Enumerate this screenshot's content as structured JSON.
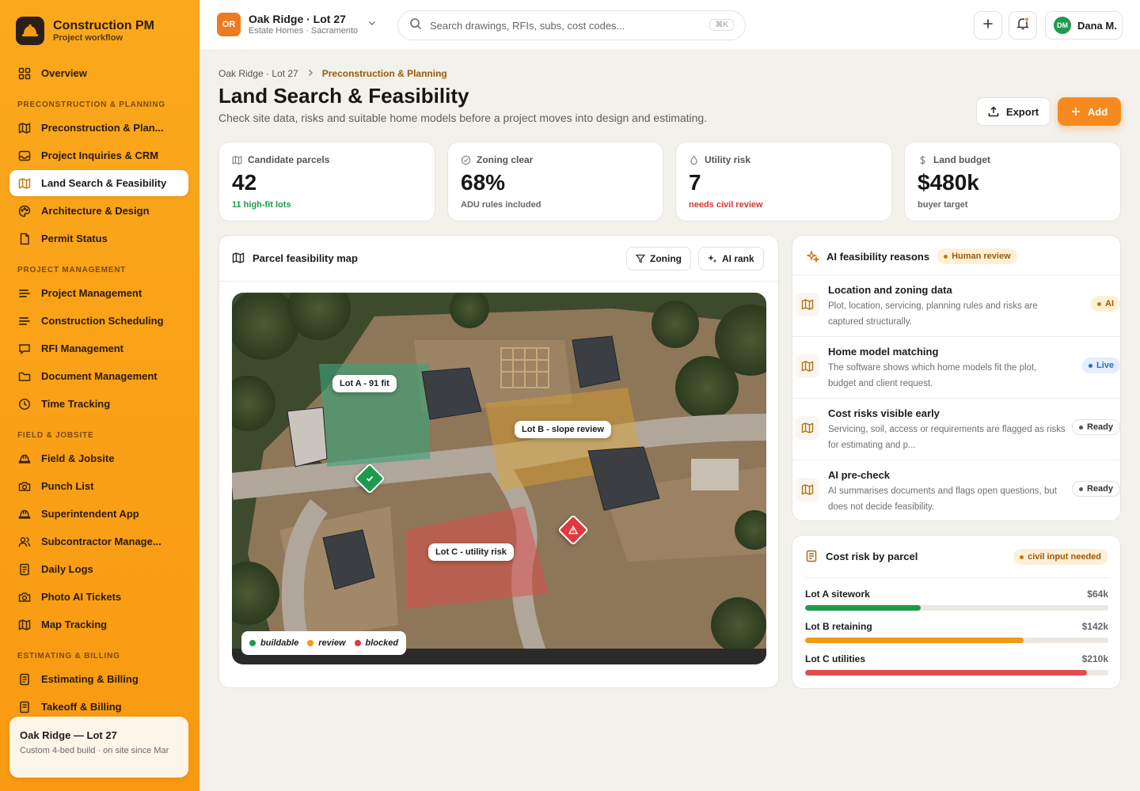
{
  "brand": {
    "title": "Construction PM",
    "subtitle": "Project workflow"
  },
  "sidebar": {
    "overview": "Overview",
    "sections": [
      {
        "title": "PRECONSTRUCTION & PLANNING",
        "items": [
          {
            "label": "Preconstruction & Plan...",
            "icon": "map-icon"
          },
          {
            "label": "Project Inquiries & CRM",
            "icon": "inbox-icon"
          },
          {
            "label": "Land Search & Feasibility",
            "icon": "map-icon",
            "active": true
          },
          {
            "label": "Architecture & Design",
            "icon": "palette-icon"
          },
          {
            "label": "Permit Status",
            "icon": "document-icon"
          }
        ]
      },
      {
        "title": "PROJECT MANAGEMENT",
        "items": [
          {
            "label": "Project Management",
            "icon": "list-icon"
          },
          {
            "label": "Construction Scheduling",
            "icon": "list-icon"
          },
          {
            "label": "RFI Management",
            "icon": "message-icon"
          },
          {
            "label": "Document Management",
            "icon": "folder-icon"
          },
          {
            "label": "Time Tracking",
            "icon": "clock-icon"
          }
        ]
      },
      {
        "title": "FIELD & JOBSITE",
        "items": [
          {
            "label": "Field & Jobsite",
            "icon": "hardhat-icon"
          },
          {
            "label": "Punch List",
            "icon": "camera-icon"
          },
          {
            "label": "Superintendent App",
            "icon": "hardhat-icon"
          },
          {
            "label": "Subcontractor Manage...",
            "icon": "users-icon"
          },
          {
            "label": "Daily Logs",
            "icon": "document-icon"
          },
          {
            "label": "Photo AI Tickets",
            "icon": "camera-icon"
          },
          {
            "label": "Map Tracking",
            "icon": "map-icon"
          }
        ]
      },
      {
        "title": "ESTIMATING & BILLING",
        "items": [
          {
            "label": "Estimating & Billing",
            "icon": "document-icon"
          },
          {
            "label": "Takeoff & Billing",
            "icon": "document-icon"
          }
        ]
      }
    ],
    "project_card": {
      "title": "Oak Ridge — Lot 27",
      "subtitle": "Custom 4-bed build · on site since Mar"
    }
  },
  "topbar": {
    "project_initials": "OR",
    "project_name": "Oak Ridge · Lot 27",
    "project_org": "Estate Homes · Sacramento",
    "search_placeholder": "Search drawings, RFIs, subs, cost codes...",
    "search_shortcut": "⌘K",
    "user_initials": "DM",
    "user_name": "Dana M."
  },
  "header": {
    "breadcrumb_root": "Oak Ridge · Lot 27",
    "breadcrumb_current": "Preconstruction & Planning",
    "title": "Land Search & Feasibility",
    "subtitle": "Check site data, risks and suitable home models before a project moves into design and estimating.",
    "export_label": "Export",
    "add_label": "Add"
  },
  "kpis": [
    {
      "label": "Candidate parcels",
      "value": "42",
      "note": "11 high-fit lots",
      "note_color": "#1e9a4c",
      "icon": "map-icon"
    },
    {
      "label": "Zoning clear",
      "value": "68%",
      "note": "ADU rules included",
      "note_color": "#666666",
      "icon": "shield-check-icon"
    },
    {
      "label": "Utility risk",
      "value": "7",
      "note": "needs civil review",
      "note_color": "#d9362f",
      "icon": "droplet-icon"
    },
    {
      "label": "Land budget",
      "value": "$480k",
      "note": "buyer target",
      "note_color": "#666666",
      "icon": "dollar-icon"
    }
  ],
  "map_panel": {
    "title": "Parcel feasibility map",
    "zoning_label": "Zoning",
    "airank_label": "AI rank",
    "labels": {
      "lot_a": "Lot A - 91 fit",
      "lot_b": "Lot B - slope review",
      "lot_c": "Lot C - utility risk"
    },
    "legend": [
      {
        "label": "buildable",
        "color": "#1e9a4c"
      },
      {
        "label": "review",
        "color": "#f29a12"
      },
      {
        "label": "blocked",
        "color": "#e0393f"
      }
    ]
  },
  "ai_panel": {
    "title": "AI feasibility reasons",
    "badge": "Human review",
    "rows": [
      {
        "title": "Location and zoning data",
        "desc": "Plot, location, servicing, planning rules and risks are captured structurally.",
        "badge": "AI",
        "badge_style": "amber"
      },
      {
        "title": "Home model matching",
        "desc": "The software shows which home models fit the plot, budget and client request.",
        "badge": "Live",
        "badge_style": "blue"
      },
      {
        "title": "Cost risks visible early",
        "desc": "Servicing, soil, access or requirements are flagged as risks for estimating and p...",
        "badge": "Ready",
        "badge_style": "gray"
      },
      {
        "title": "AI pre-check",
        "desc": "AI summarises documents and flags open questions, but does not decide feasibility.",
        "badge": "Ready",
        "badge_style": "gray"
      }
    ]
  },
  "cost_panel": {
    "title": "Cost risk by parcel",
    "badge": "civil input needed",
    "rows": [
      {
        "label": "Lot A sitework",
        "value": "$64k",
        "fraction": 0.38,
        "color": "#1e9a4c"
      },
      {
        "label": "Lot B retaining",
        "value": "$142k",
        "fraction": 0.72,
        "color": "#f29a12"
      },
      {
        "label": "Lot C utilities",
        "value": "$210k",
        "fraction": 0.93,
        "color": "#e24b4b"
      }
    ]
  }
}
